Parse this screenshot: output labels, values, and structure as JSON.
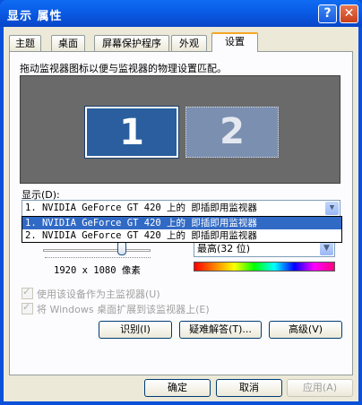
{
  "window": {
    "title": "显示 属性",
    "help": "?",
    "close": "✕"
  },
  "tabs": [
    {
      "label": "主题"
    },
    {
      "label": "桌面"
    },
    {
      "label": "屏幕保护程序"
    },
    {
      "label": "外观"
    },
    {
      "label": "设置"
    }
  ],
  "settings": {
    "instruction": "拖动监视器图标以便与监视器的物理设置匹配。",
    "monitors": [
      {
        "label": "1"
      },
      {
        "label": "2"
      }
    ],
    "display_label": "显示(D):",
    "display_value": "1. NVIDIA GeForce GT 420 上的 即插即用监视器",
    "display_options": [
      "1. NVIDIA GeForce GT 420 上的 即插即用监视器",
      "2. NVIDIA GeForce GT 420 上的 即插即用监视器"
    ],
    "resolution": "1920 x 1080 像素",
    "color_quality": "最高(32 位)",
    "primary_checkbox": "使用该设备作为主监视器(U)",
    "extend_checkbox": "将 Windows 桌面扩展到该监视器上(E)",
    "identify_button": "识别(I)",
    "troubleshoot_button": "疑难解答(T)...",
    "advanced_button": "高级(V)"
  },
  "footer": {
    "ok": "确定",
    "cancel": "取消",
    "apply": "应用(A)"
  }
}
